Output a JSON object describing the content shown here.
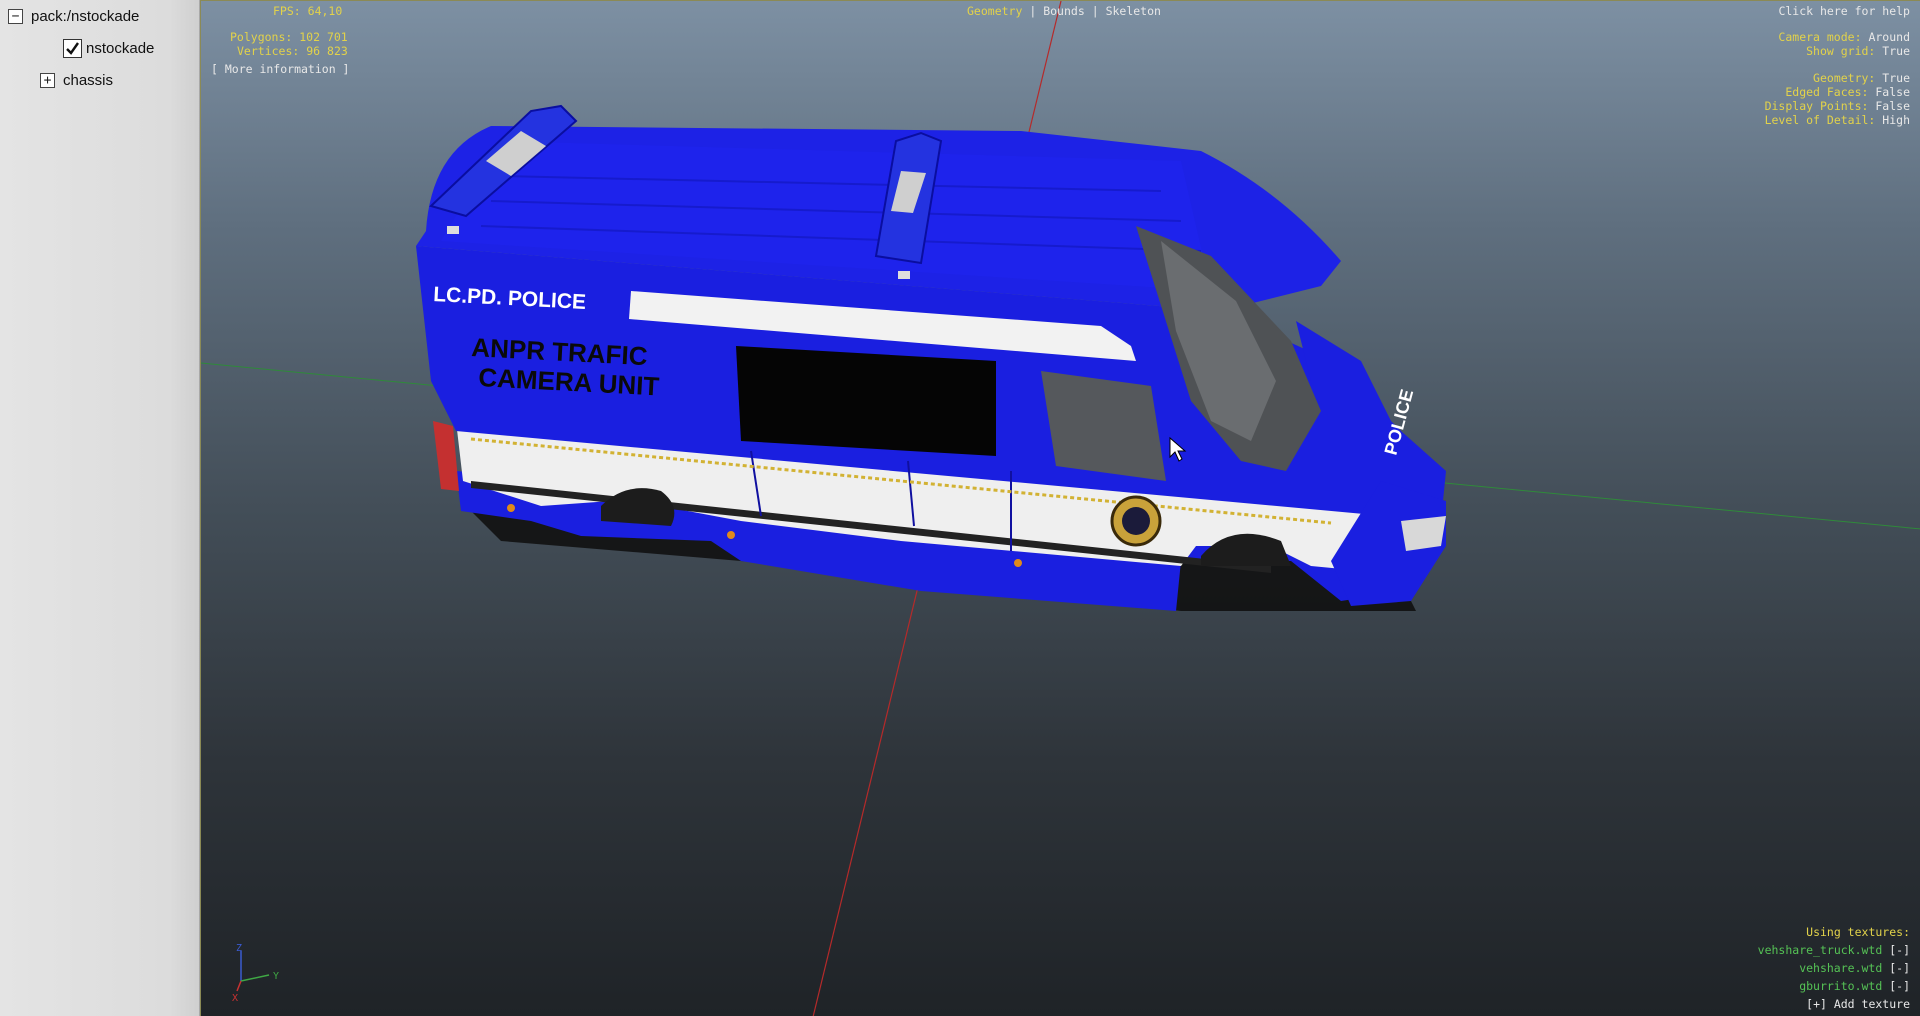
{
  "tree": {
    "root_label": "pack:/nstockade",
    "model_label": "nstockade",
    "chassis_label": "chassis"
  },
  "hud": {
    "fps_label": "FPS:",
    "fps_value": "64,10",
    "polygons_label": "Polygons:",
    "polygons_value": "102 701",
    "vertices_label": "Vertices:",
    "vertices_value": "96 823",
    "more_info": "[ More information ]",
    "tabs": [
      "Geometry",
      "Bounds",
      "Skeleton"
    ],
    "separator": "|",
    "help": "Click here for help",
    "camera_mode_label": "Camera mode:",
    "camera_mode_value": "Around",
    "show_grid_label": "Show grid:",
    "show_grid_value": "True",
    "geometry_label": "Geometry:",
    "geometry_value": "True",
    "edged_faces_label": "Edged Faces:",
    "edged_faces_value": "False",
    "display_points_label": "Display Points:",
    "display_points_value": "False",
    "lod_label": "Level of Detail:",
    "lod_value": "High",
    "using_textures": "Using textures:",
    "textures": [
      {
        "name": "vehshare_truck.wtd",
        "action": "[-]"
      },
      {
        "name": "vehshare.wtd",
        "action": "[-]"
      },
      {
        "name": "gburrito.wtd",
        "action": "[-]"
      }
    ],
    "add_texture": "[+] Add texture",
    "axis_z": "Z",
    "axis_y": "Y",
    "axis_x": "X"
  },
  "vehicle": {
    "header_text": "LC.PD.  POLICE",
    "side_line1": "ANPR TRAFIC",
    "side_line2": "CAMERA UNIT",
    "hood_text": "POLICE",
    "body_color": "#1a1fe0",
    "stripe_color": "#f2f2f2"
  },
  "colors": {
    "hud_yellow": "#e2d24a",
    "hud_green": "#55c255",
    "axis_red": "#b52a2a",
    "axis_green": "#2f8a3a"
  }
}
